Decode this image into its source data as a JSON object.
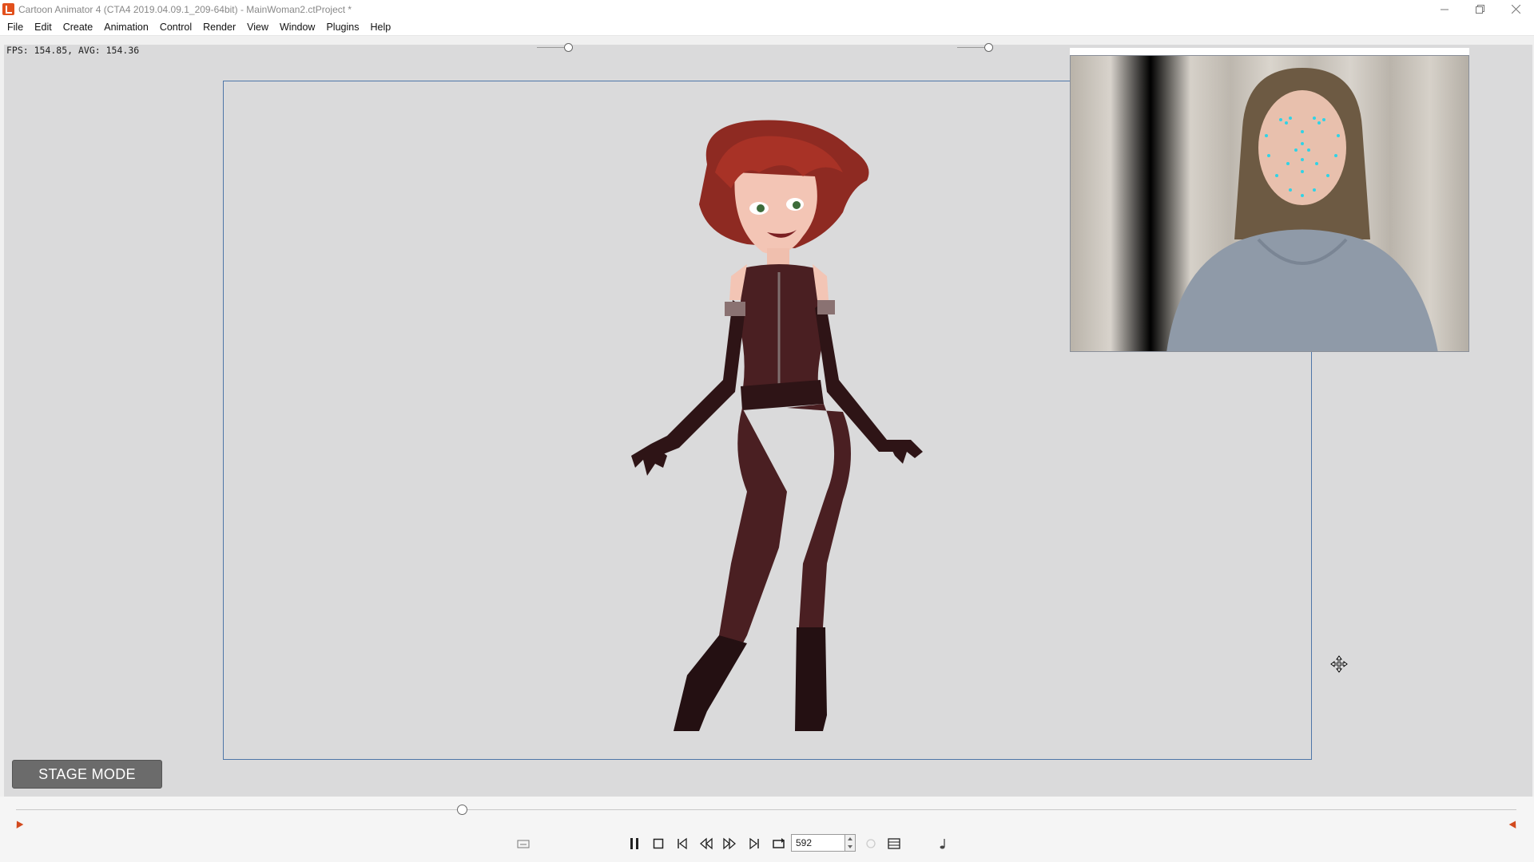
{
  "window": {
    "title": "Cartoon Animator 4  (CTA4 2019.04.09.1_209-64bit) - MainWoman2.ctProject *",
    "icon": "cartoon-animator-icon",
    "controls": [
      "minimize-icon",
      "restore-icon",
      "close-icon"
    ]
  },
  "menu": {
    "items": [
      "File",
      "Edit",
      "Create",
      "Animation",
      "Control",
      "Render",
      "View",
      "Window",
      "Plugins",
      "Help"
    ]
  },
  "viewport": {
    "fps_text": "FPS: 154.85, AVG: 154.36",
    "stage_mode_label": "STAGE MODE",
    "background_color": "#dadadb",
    "frame_color": "#4e76a8"
  },
  "timeline": {
    "current_frame": "592",
    "marker_color": "#d24a1e",
    "icons": [
      "caption-icon",
      "pause-icon",
      "stop-icon",
      "first-frame-icon",
      "prev-frame-icon",
      "next-frame-icon",
      "last-frame-icon",
      "loop-icon",
      "onion-skin-icon",
      "timeline-panel-icon",
      "audio-note-icon"
    ]
  }
}
